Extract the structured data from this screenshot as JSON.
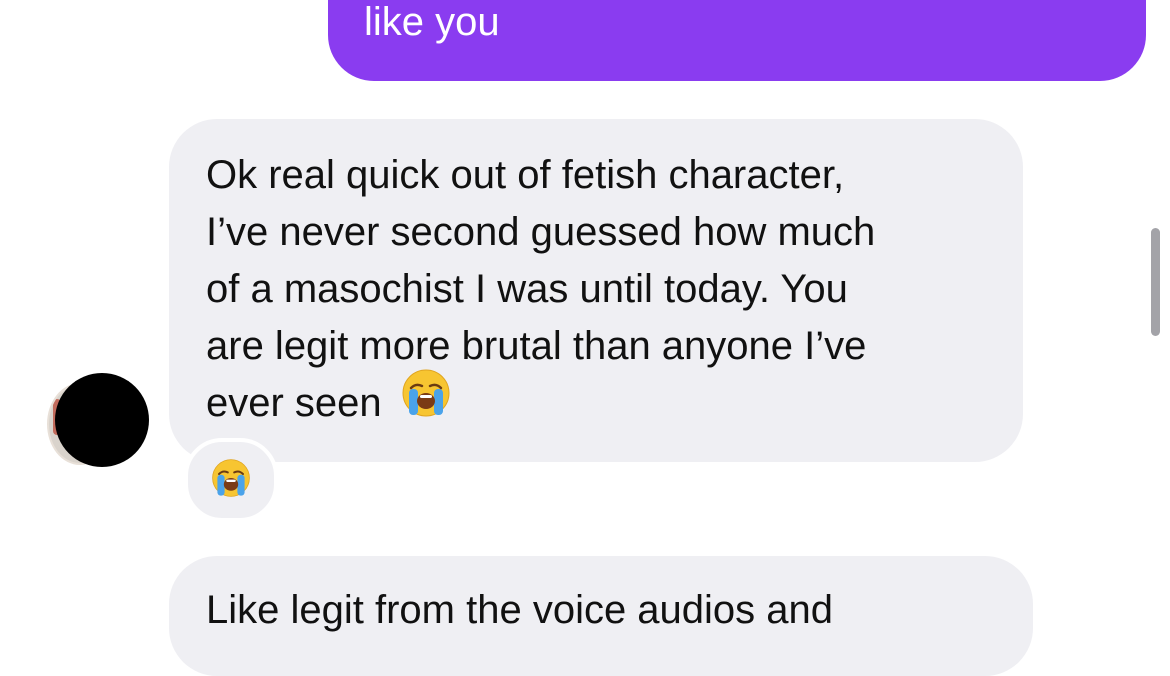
{
  "messages": {
    "outgoing": {
      "text": "like you",
      "color": "#8a3cf0"
    },
    "incoming_1": {
      "lines": [
        "Ok real quick out of fetish character,",
        "I’ve never second guessed how much",
        "of a masochist I was until today. You",
        "are legit more brutal than anyone I’ve",
        "ever seen"
      ],
      "inline_emoji": "loudly-crying-face",
      "reaction": "loudly-crying-face"
    },
    "incoming_2": {
      "text": "Like legit from  the voice audios and"
    }
  },
  "avatar": {
    "icon": "avatar-redacted"
  },
  "colors": {
    "incoming_bubble": "#efeff3",
    "outgoing_bubble": "#8a3cf0",
    "text": "#111111"
  }
}
